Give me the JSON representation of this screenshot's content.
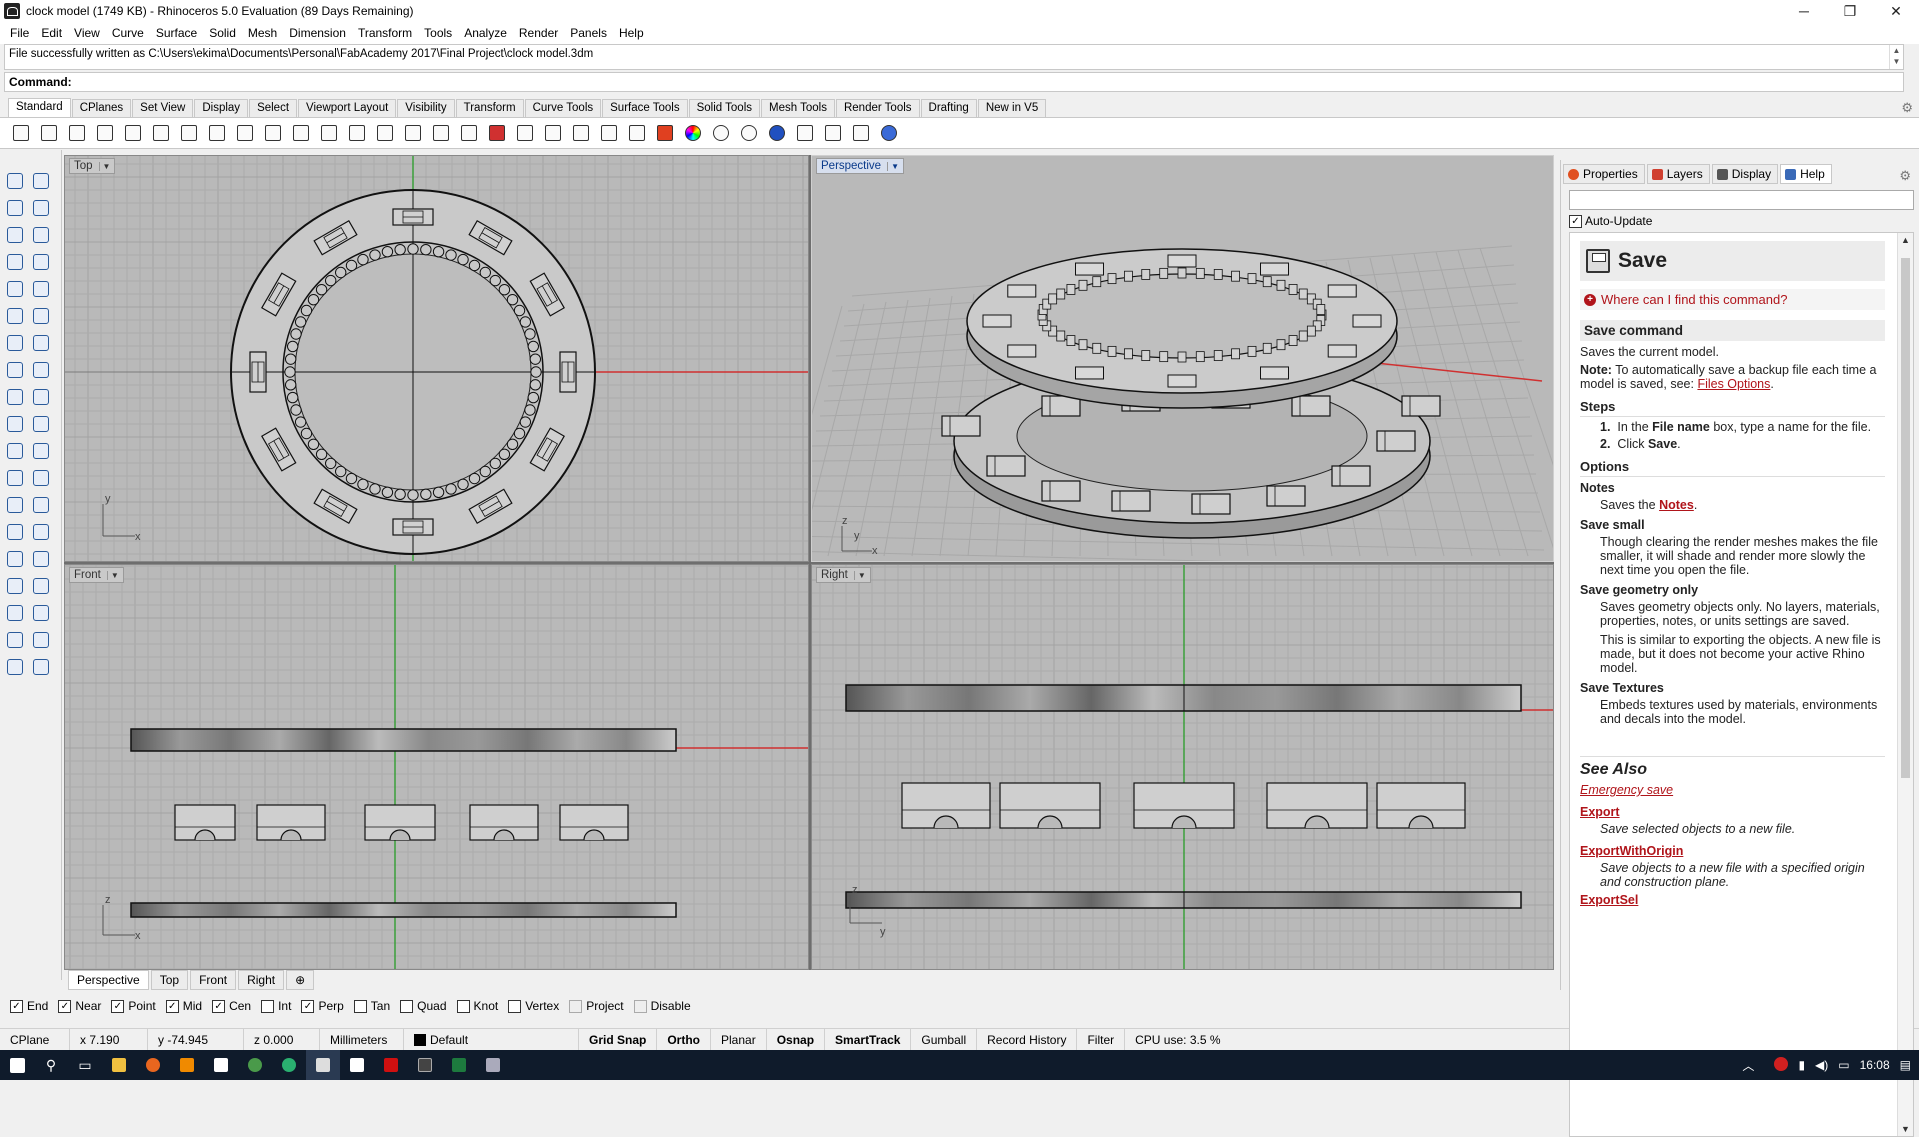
{
  "window": {
    "title": "clock model (1749 KB) - Rhinoceros 5.0 Evaluation (89 Days Remaining)",
    "minimize": "─",
    "restore": "❐",
    "close": "✕"
  },
  "menu": [
    "File",
    "Edit",
    "View",
    "Curve",
    "Surface",
    "Solid",
    "Mesh",
    "Dimension",
    "Transform",
    "Tools",
    "Analyze",
    "Render",
    "Panels",
    "Help"
  ],
  "history_text": "File successfully written as C:\\Users\\ekima\\Documents\\Personal\\FabAcademy 2017\\Final Project\\clock model.3dm",
  "command_label": "Command:",
  "toolbar_tabs": [
    "Standard",
    "CPlanes",
    "Set View",
    "Display",
    "Select",
    "Viewport Layout",
    "Visibility",
    "Transform",
    "Curve Tools",
    "Surface Tools",
    "Solid Tools",
    "Mesh Tools",
    "Render Tools",
    "Drafting",
    "New in V5"
  ],
  "toolbar_icons": [
    "new-icon",
    "open-icon",
    "save-icon",
    "print-icon",
    "import-icon",
    "cut-icon",
    "copy-icon",
    "paste-icon",
    "undo-icon",
    "pan-icon",
    "move-view-icon",
    "zoom-icon",
    "zoom-window-icon",
    "zoom-extents-icon",
    "zoom-selected-icon",
    "rotate-view-icon",
    "four-viewports-icon",
    "car-icon",
    "osnap-icon",
    "point-icon",
    "gumball-icon",
    "light-icon",
    "lock-icon",
    "layer-icon",
    "color-wheel-icon",
    "render-sphere-icon",
    "shaded-sphere-icon",
    "rendered-sphere-icon",
    "light-wand-icon",
    "gear-tools-icon",
    "dimension-icon",
    "help-icon"
  ],
  "viewports": {
    "top": {
      "label": "Top"
    },
    "perspective": {
      "label": "Perspective"
    },
    "front": {
      "label": "Front"
    },
    "right": {
      "label": "Right"
    }
  },
  "viewport_tabs": [
    "Perspective",
    "Top",
    "Front",
    "Right"
  ],
  "viewport_tab_add": "⊕",
  "osnaps": [
    {
      "label": "End",
      "checked": true
    },
    {
      "label": "Near",
      "checked": true
    },
    {
      "label": "Point",
      "checked": true
    },
    {
      "label": "Mid",
      "checked": true
    },
    {
      "label": "Cen",
      "checked": true
    },
    {
      "label": "Int",
      "checked": false
    },
    {
      "label": "Perp",
      "checked": true
    },
    {
      "label": "Tan",
      "checked": false
    },
    {
      "label": "Quad",
      "checked": false
    },
    {
      "label": "Knot",
      "checked": false
    },
    {
      "label": "Vertex",
      "checked": false
    },
    {
      "label": "Project",
      "checked": false
    },
    {
      "label": "Disable",
      "checked": false
    }
  ],
  "status": {
    "cplane": "CPlane",
    "x": "x 7.190",
    "y": "y -74.945",
    "z": "z 0.000",
    "units": "Millimeters",
    "layer": "Default",
    "grid_snap": "Grid Snap",
    "ortho": "Ortho",
    "planar": "Planar",
    "osnap": "Osnap",
    "smarttrack": "SmartTrack",
    "gumball": "Gumball",
    "record_history": "Record History",
    "filter": "Filter",
    "cpu": "CPU use: 3.5 %"
  },
  "panel_tabs": [
    "Properties",
    "Layers",
    "Display",
    "Help"
  ],
  "auto_update": "Auto-Update",
  "help": {
    "title": "Save",
    "where": "Where can I find this command?",
    "section": "Save command",
    "desc": "Saves the current model.",
    "note_label": "Note:",
    "note_text": "To automatically save a backup file each time a model is saved, see:",
    "note_link": "Files Options",
    "steps_title": "Steps",
    "step1_a": "In the",
    "step1_b": "File name",
    "step1_c": "box, type a name for the file.",
    "step2_a": "Click",
    "step2_b": "Save",
    "options_title": "Options",
    "notes_title": "Notes",
    "notes_a": "Saves the",
    "notes_link": "Notes",
    "savesmall_title": "Save small",
    "savesmall_text": "Though clearing the render meshes makes the file smaller, it will shade and render more slowly the next time you open the file.",
    "savegeom_title": "Save geometry only",
    "savegeom_text1": "Saves geometry objects only. No layers, materials, properties, notes, or units settings are saved.",
    "savegeom_text2": "This is similar to exporting the objects. A new file is made, but it does not become your active Rhino model.",
    "savetex_title": "Save Textures",
    "savetex_text": "Embeds textures used by materials, environments and decals into the model.",
    "seealso_title": "See Also",
    "link1": "Emergency save",
    "link2": "Export",
    "link2_desc": "Save selected objects to a new file.",
    "link3": "ExportWithOrigin",
    "link3_desc": "Save objects to a new file with a specified origin and construction plane.",
    "link4": "ExportSel"
  },
  "taskbar": {
    "time": "16:08",
    "tray_up": "︿"
  }
}
